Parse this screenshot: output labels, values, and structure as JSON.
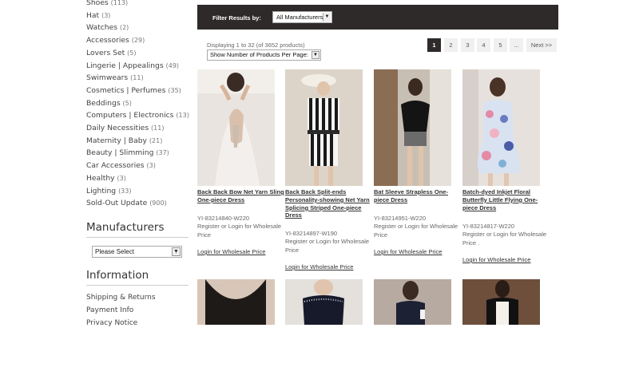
{
  "sidebar": {
    "categories": [
      {
        "name": "Shoes",
        "count": "(113)"
      },
      {
        "name": "Hat",
        "count": "(3)"
      },
      {
        "name": "Watches",
        "count": "(2)"
      },
      {
        "name": "Accessories",
        "count": "(29)"
      },
      {
        "name": "Lovers Set",
        "count": "(5)"
      },
      {
        "name": "Lingerie | Appealings",
        "count": "(49)"
      },
      {
        "name": "Swimwears",
        "count": "(11)"
      },
      {
        "name": "Cosmetics | Perfumes",
        "count": "(35)"
      },
      {
        "name": "Beddings",
        "count": "(5)"
      },
      {
        "name": "Computers | Electronics",
        "count": "(13)"
      },
      {
        "name": "Daily Necessities",
        "count": "(11)"
      },
      {
        "name": "Maternity | Baby",
        "count": "(21)"
      },
      {
        "name": "Beauty | Slimming",
        "count": "(37)"
      },
      {
        "name": "Car Accessories",
        "count": "(3)"
      },
      {
        "name": "Healthy",
        "count": "(3)"
      },
      {
        "name": "Lighting",
        "count": "(33)"
      },
      {
        "name": "Sold-Out Update",
        "count": "(900)"
      }
    ],
    "manufacturers_heading": "Manufacturers",
    "manufacturers_select": "Please Select",
    "information_heading": "Information",
    "info_links": [
      "Shipping & Returns",
      "Payment Info",
      "Privacy Notice"
    ]
  },
  "filter": {
    "label": "Filter Results by:",
    "selected": "All Manufacturers"
  },
  "listing": {
    "display_text": "Displaying 1 to 32 (of 3652 products)",
    "per_page": "Show Number of Products Per Page:"
  },
  "pagination": [
    "1",
    "2",
    "3",
    "4",
    "5",
    "...",
    "Next >>"
  ],
  "products": [
    {
      "name": "Back Back Bow Net Yarn Sling One-piece Dress",
      "sku": "YI-83214840-W220",
      "register": "Register or Login for Wholesale Price",
      "login": "Login for Wholesale Price"
    },
    {
      "name": "Back Back Split-ends Personality-showing Net Yarn Splicing Striped One-piece Dress",
      "sku": "YI-83214897-W190",
      "register": "Register or Login for Wholesale Price",
      "login": "Login for Wholesale Price"
    },
    {
      "name": "Bat Sleeve Strapless One-piece Dress",
      "sku": "YI-83214951-W220",
      "register": "Register or Login for Wholesale Price",
      "login": "Login for Wholesale Price"
    },
    {
      "name": "Batch-dyed Inkjet Floral Butterfly Little Flying One-piece Dress",
      "sku": "YI-83214817-W220",
      "register": "Register or Login for Wholesale Price .",
      "login": "Login for Wholesale Price"
    }
  ],
  "colors": {
    "dark_bar": "#2e2a29",
    "page_bg": "#f0f0f0"
  }
}
